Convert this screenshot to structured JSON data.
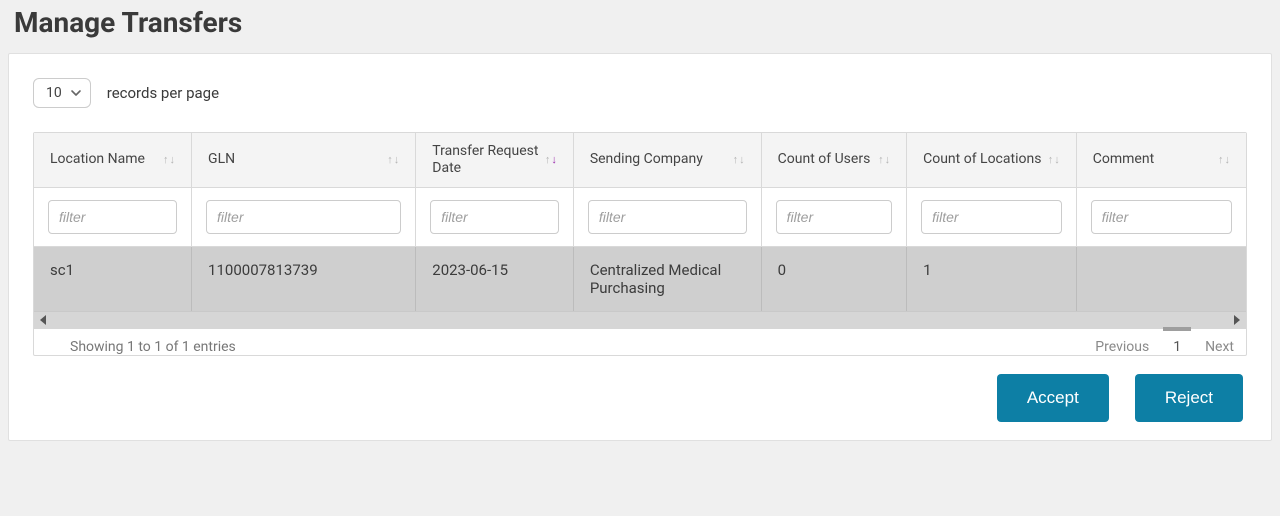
{
  "title": "Manage Transfers",
  "page_size": {
    "value": "10",
    "label": "records per page"
  },
  "columns": [
    {
      "key": "location_name",
      "label": "Location Name",
      "filter_placeholder": "filter",
      "sort": "none"
    },
    {
      "key": "gln",
      "label": "GLN",
      "filter_placeholder": "filter",
      "sort": "none"
    },
    {
      "key": "transfer_date",
      "label": "Transfer Request Date",
      "filter_placeholder": "filter",
      "sort": "desc"
    },
    {
      "key": "sending_company",
      "label": "Sending Company",
      "filter_placeholder": "filter",
      "sort": "none"
    },
    {
      "key": "count_users",
      "label": "Count of Users",
      "filter_placeholder": "filter",
      "sort": "none"
    },
    {
      "key": "count_locations",
      "label": "Count of Locations",
      "filter_placeholder": "filter",
      "sort": "none"
    },
    {
      "key": "comment",
      "label": "Comment",
      "filter_placeholder": "filter",
      "sort": "none"
    }
  ],
  "rows": [
    {
      "location_name": "sc1",
      "gln": "1100007813739",
      "transfer_date": "2023-06-15",
      "sending_company": "Centralized Medical Purchasing",
      "count_users": "0",
      "count_locations": "1",
      "comment": ""
    }
  ],
  "footer": {
    "summary": "Showing 1 to 1 of 1 entries",
    "previous": "Previous",
    "next": "Next",
    "current_page": "1"
  },
  "actions": {
    "accept": "Accept",
    "reject": "Reject"
  }
}
